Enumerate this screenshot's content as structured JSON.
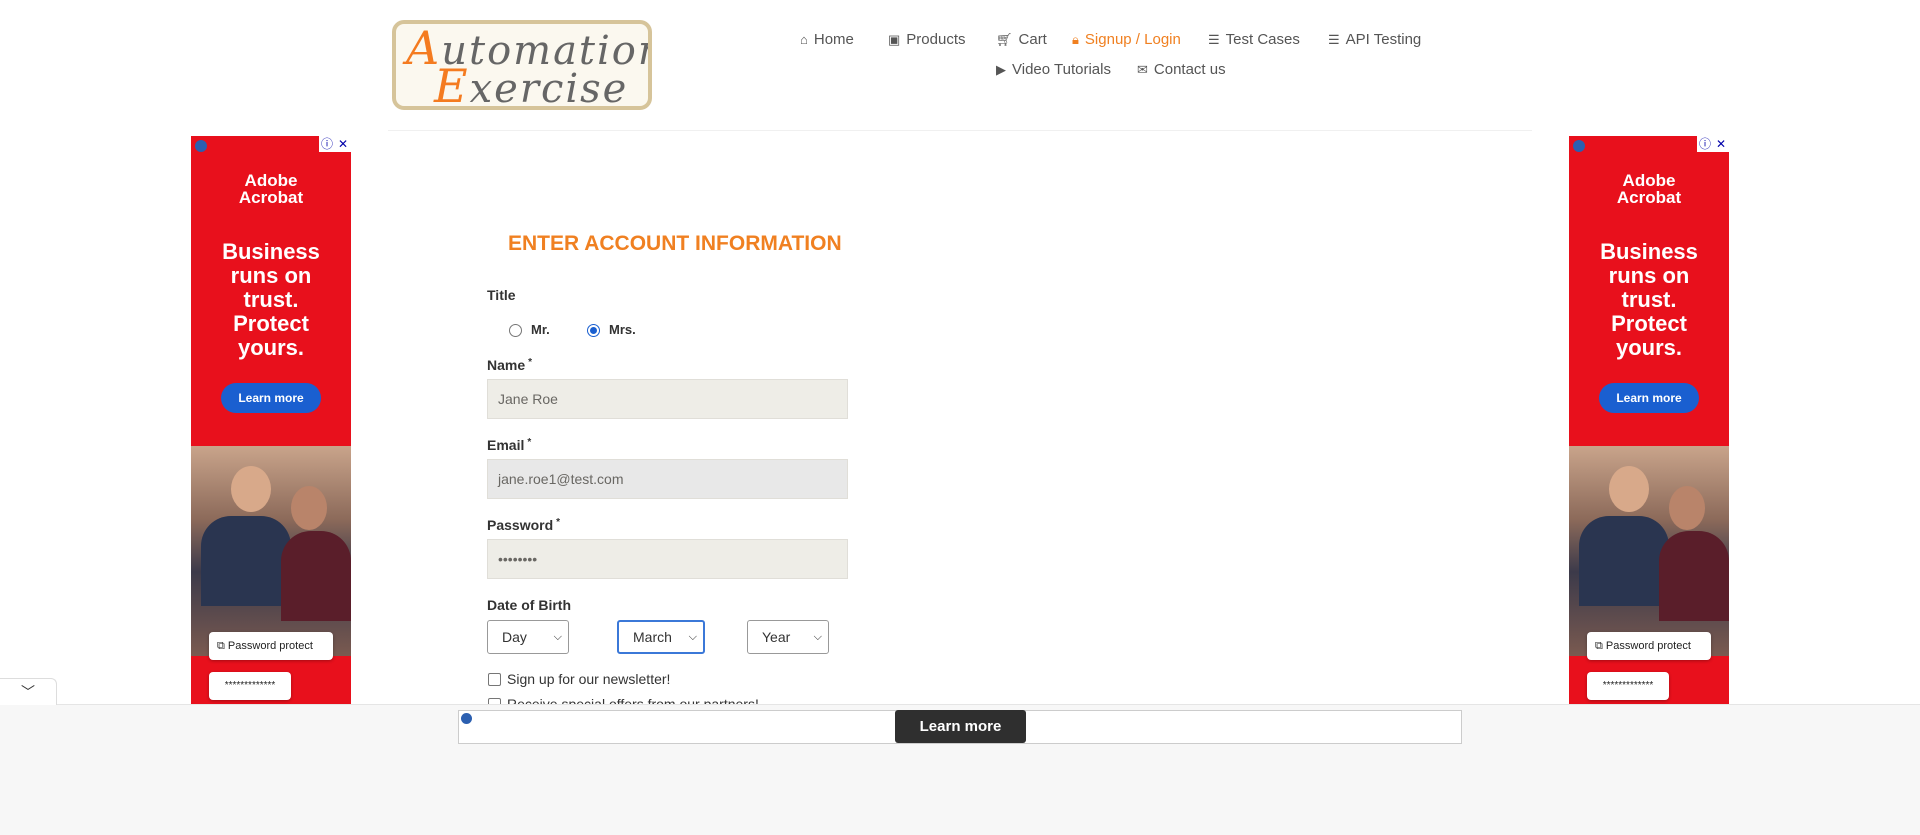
{
  "logo": {
    "line1_cap": "A",
    "line1_rest": "utomation",
    "line2_cap": "E",
    "line2_rest": "xercise"
  },
  "nav": {
    "items": [
      {
        "label": "Home",
        "icon": "home-icon"
      },
      {
        "label": "Products",
        "icon": "briefcase-icon"
      },
      {
        "label": "Cart",
        "icon": "cart-icon"
      },
      {
        "label": "Signup / Login",
        "icon": "lock-icon",
        "active": true
      },
      {
        "label": "Test Cases",
        "icon": "list-icon"
      },
      {
        "label": "API Testing",
        "icon": "list-icon"
      },
      {
        "label": "Video Tutorials",
        "icon": "youtube-icon"
      },
      {
        "label": "Contact us",
        "icon": "envelope-icon"
      }
    ],
    "active_color": "#f08021"
  },
  "side_ad": {
    "brand_line1": "Adobe",
    "brand_line2": "Acrobat",
    "headline": [
      "Business",
      "runs on",
      "trust.",
      "Protect",
      "yours."
    ],
    "cta": "Learn more",
    "password_label": "Password protect",
    "password_mask": "*************",
    "info": "ⓘ",
    "close": "✕",
    "bg_color": "#e8101c"
  },
  "form": {
    "heading": "ENTER ACCOUNT INFORMATION",
    "title_label": "Title",
    "title_options": [
      {
        "label": "Mr.",
        "selected": false
      },
      {
        "label": "Mrs.",
        "selected": true
      }
    ],
    "name_label": "Name",
    "name_value": "Jane Roe",
    "email_label": "Email",
    "email_value": "jane.roe1@test.com",
    "password_label": "Password",
    "password_value": "••••••••",
    "required_mark": "*",
    "dob_label": "Date of Birth",
    "dob_day": "Day",
    "dob_month": "March",
    "dob_year": "Year",
    "newsletter_label": "Sign up for our newsletter!",
    "offers_label": "Receive special offers from our partners!"
  },
  "bottom_ad": {
    "cta": "Learn more"
  }
}
